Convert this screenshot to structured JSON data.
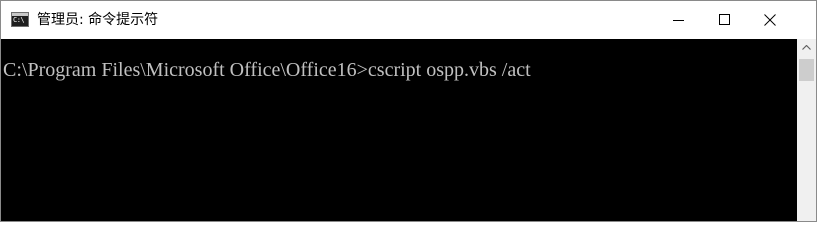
{
  "window": {
    "title": "管理员: 命令提示符",
    "icon": "cmd-icon",
    "icon_glyph": "C:\\",
    "controls": {
      "minimize": "minimize-icon",
      "maximize": "maximize-icon",
      "close": "close-icon"
    }
  },
  "console": {
    "lines": [
      "C:\\Program Files\\Microsoft Office\\Office16>cscript ospp.vbs /act"
    ],
    "background": "#000000",
    "foreground": "#c0c0c0"
  },
  "scrollbar": {
    "up_arrow": "chevron-up-icon"
  }
}
